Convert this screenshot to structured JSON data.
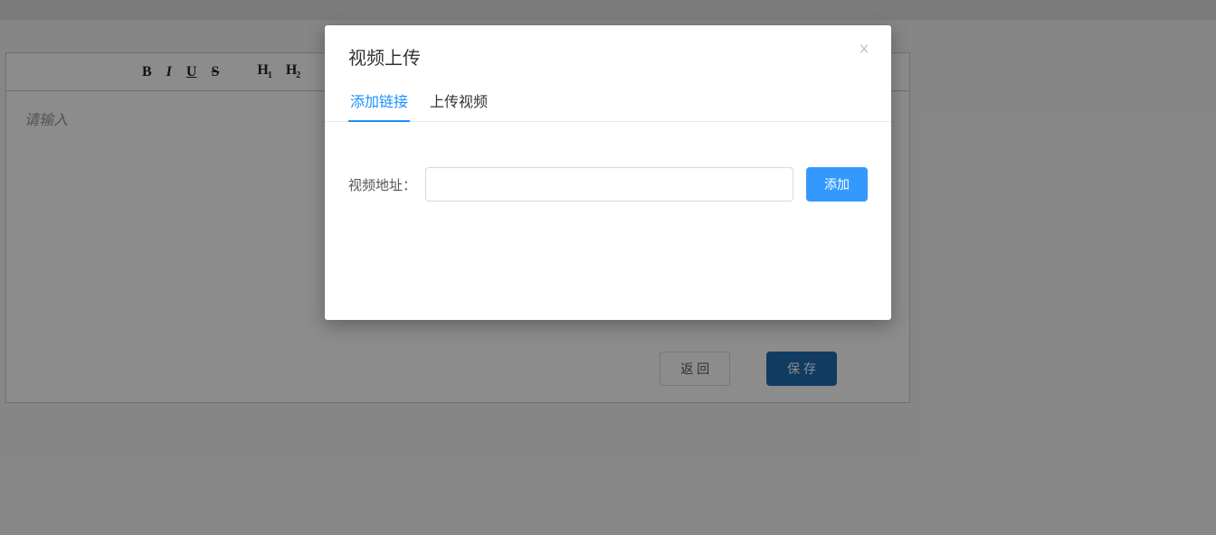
{
  "editor": {
    "placeholder": "请输入",
    "toolbar": {
      "bold": "B",
      "italic": "I",
      "underline": "U",
      "strike": "S",
      "h1": "H",
      "h1sub": "1",
      "h2": "H",
      "h2sub": "2"
    }
  },
  "footer": {
    "back": "返 回",
    "save": "保 存"
  },
  "modal": {
    "title": "视频上传",
    "tabs": {
      "addLink": "添加链接",
      "uploadVideo": "上传视频"
    },
    "form": {
      "urlLabel": "视频地址：",
      "addBtn": "添加"
    }
  }
}
